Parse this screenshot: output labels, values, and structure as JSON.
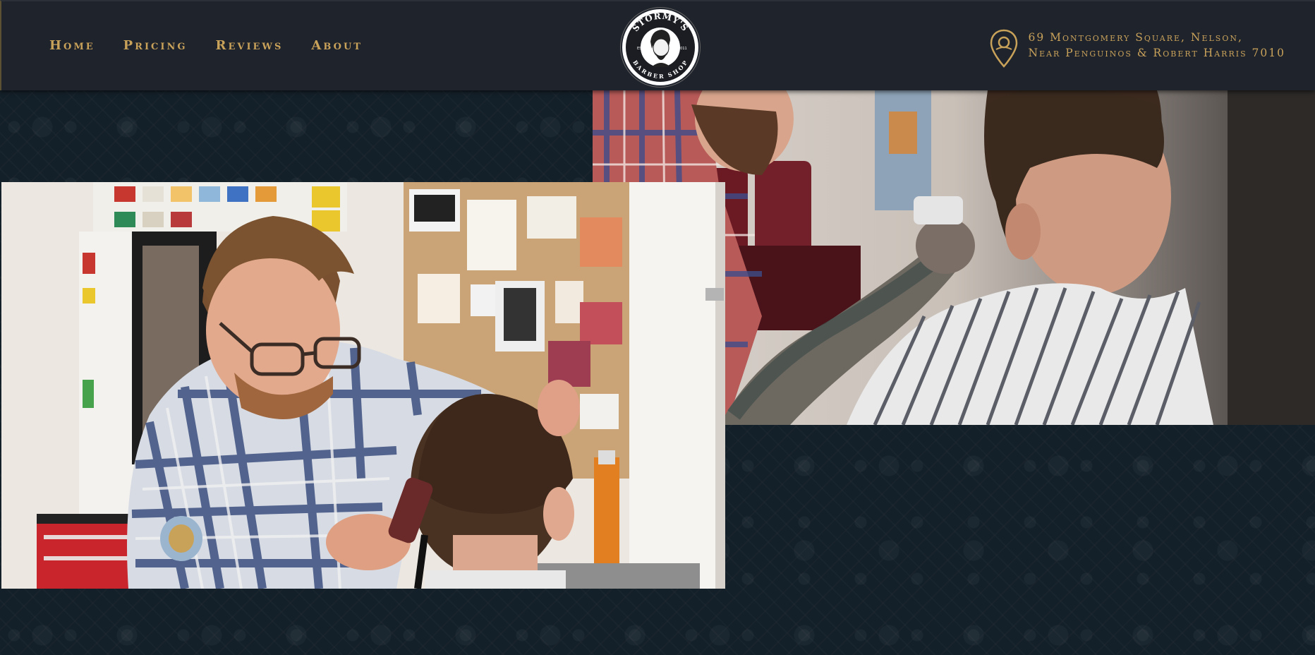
{
  "nav": {
    "items": [
      {
        "label": "Home"
      },
      {
        "label": "Pricing"
      },
      {
        "label": "Reviews"
      },
      {
        "label": "About"
      }
    ]
  },
  "logo": {
    "top_text": "STORMY'S",
    "bottom_text": "BARBER SHOP",
    "est_label": "EST.",
    "year": "2011"
  },
  "address": {
    "line1": "69 Montgomery Square, Nelson,",
    "line2": "Near Penguinos & Robert Harris 7010",
    "icon": "map-pin-icon"
  },
  "photos": [
    {
      "name": "barber-clipping-hair-photo"
    },
    {
      "name": "tattooed-barber-cutting-hair-photo"
    }
  ],
  "colors": {
    "accent": "#c9a25a",
    "header_bg": "#1f232c",
    "page_bg": "#142029"
  }
}
